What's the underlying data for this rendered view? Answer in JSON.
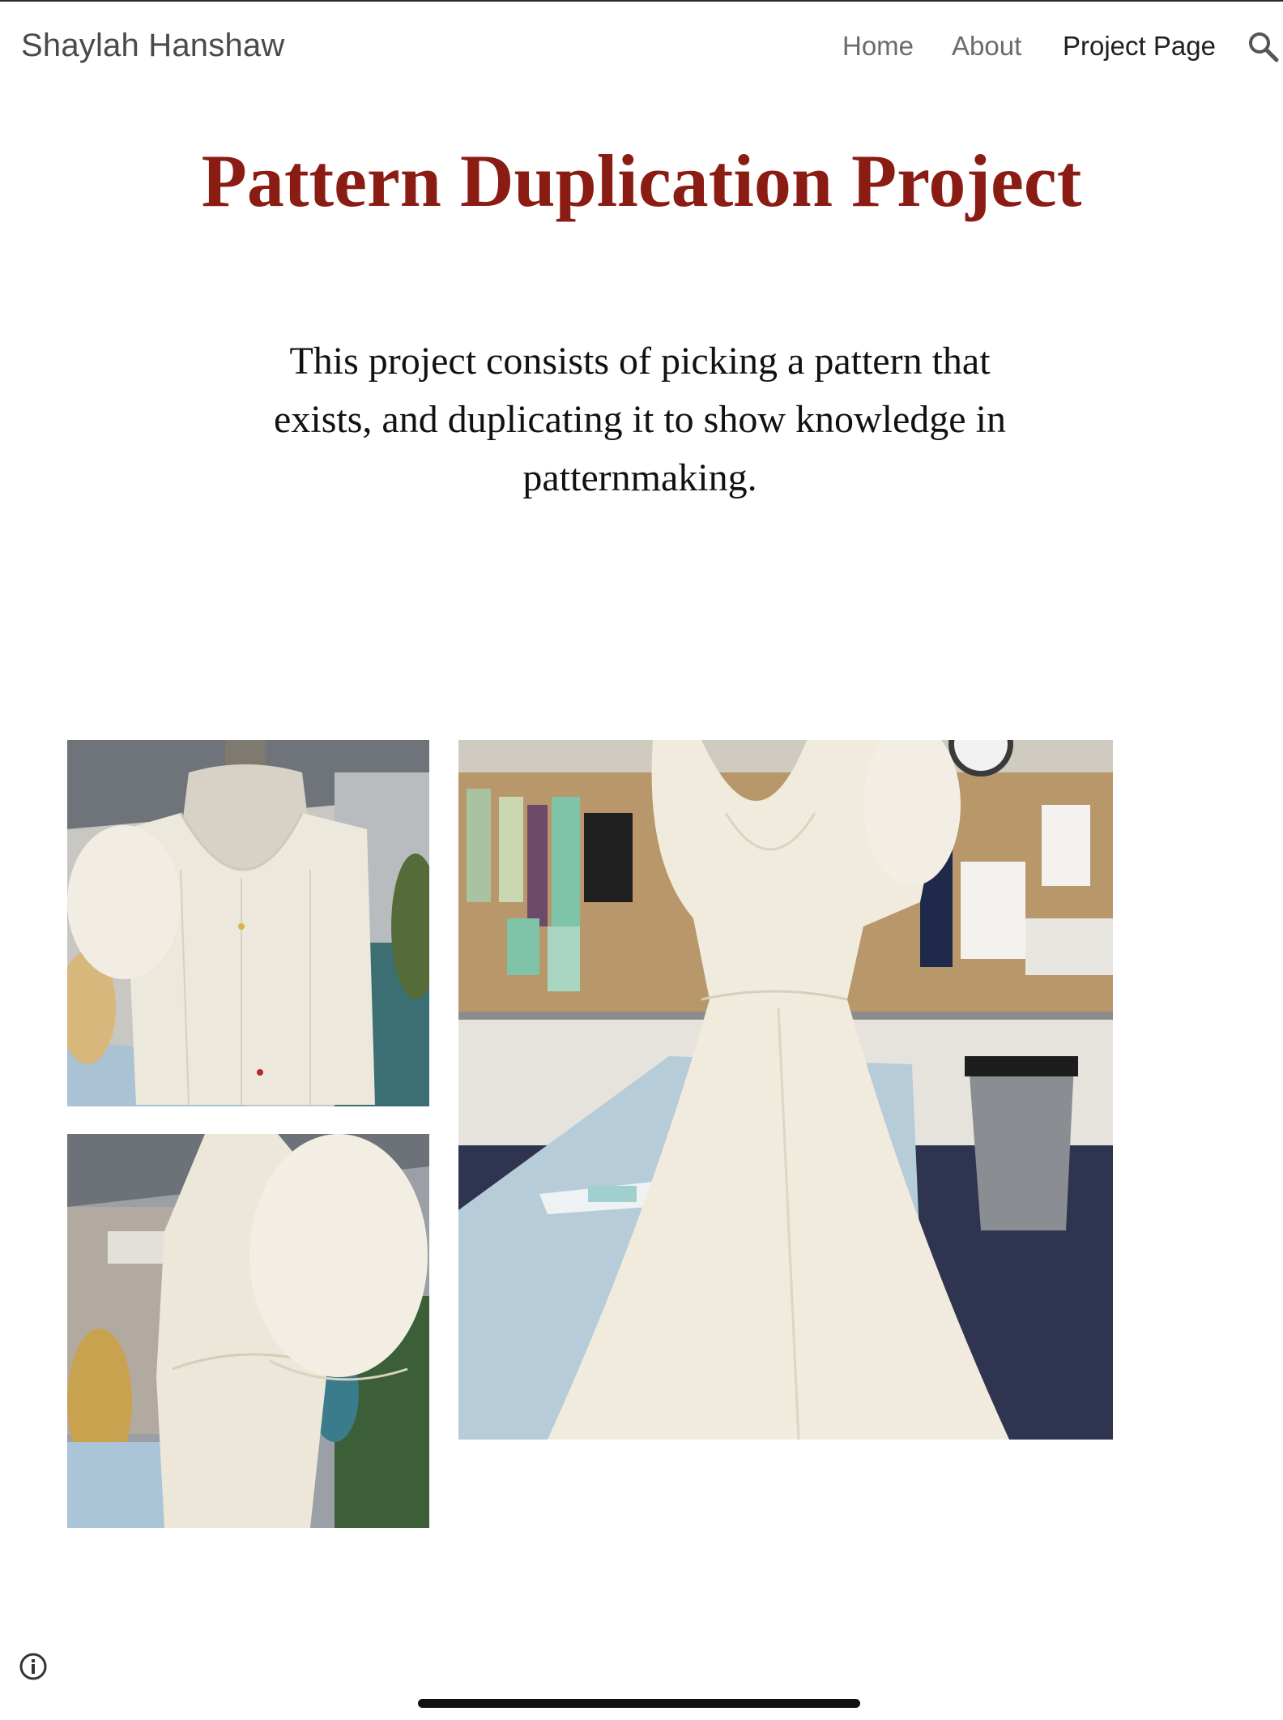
{
  "site": {
    "title": "Shaylah Hanshaw"
  },
  "nav": {
    "items": [
      {
        "label": "Home"
      },
      {
        "label": "About"
      },
      {
        "label": "Project Page",
        "active": true
      }
    ],
    "search_icon": "search-icon"
  },
  "page": {
    "title": "Pattern Duplication Project",
    "intro": "This project consists of picking a pattern that exists, and duplicating it to show knowledge in patternmaking."
  },
  "gallery": {
    "images": [
      {
        "name": "dress-back-view-photo",
        "subject": "muslin bodice back view on dress form"
      },
      {
        "name": "dress-side-view-photo",
        "subject": "muslin bodice side view with puff sleeve"
      },
      {
        "name": "dress-front-view-photo",
        "subject": "full muslin dress on dress form in classroom"
      }
    ]
  },
  "footer": {
    "info_icon": "info-icon"
  },
  "colors": {
    "title_accent": "#8b1c14",
    "text": "#111111",
    "nav_active": "#202020",
    "nav_inactive": "#6b6b6b"
  }
}
